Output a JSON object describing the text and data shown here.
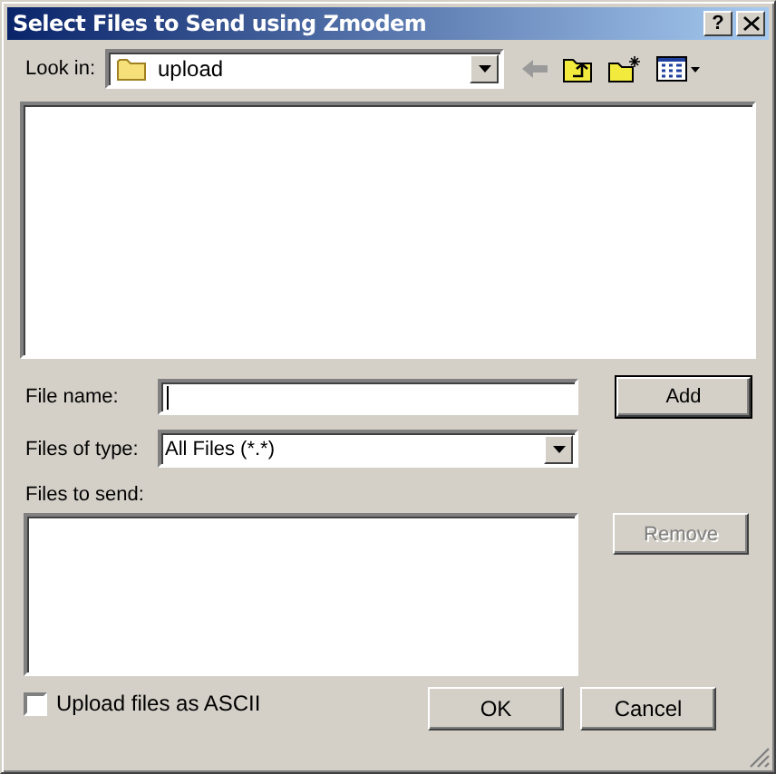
{
  "window": {
    "title": "Select Files to Send using Zmodem",
    "help_button": "?"
  },
  "look_in": {
    "label": "Look in:",
    "value": "upload"
  },
  "toolbar": [
    {
      "kind": "back",
      "disabled": true
    },
    {
      "kind": "up",
      "disabled": false
    },
    {
      "kind": "new-folder",
      "disabled": false
    },
    {
      "kind": "view",
      "disabled": false
    }
  ],
  "file_name": {
    "label": "File name:"
  },
  "add_button": "Add",
  "file_type": {
    "label": "Files of type:",
    "value": "All Files (*.*)"
  },
  "files_to_send": {
    "label": "Files to send:"
  },
  "remove_button": {
    "label": "Remove",
    "disabled": true
  },
  "ascii_option": {
    "label": "Upload files as ASCII",
    "checked": false
  },
  "buttons": [
    "OK",
    "Cancel"
  ]
}
